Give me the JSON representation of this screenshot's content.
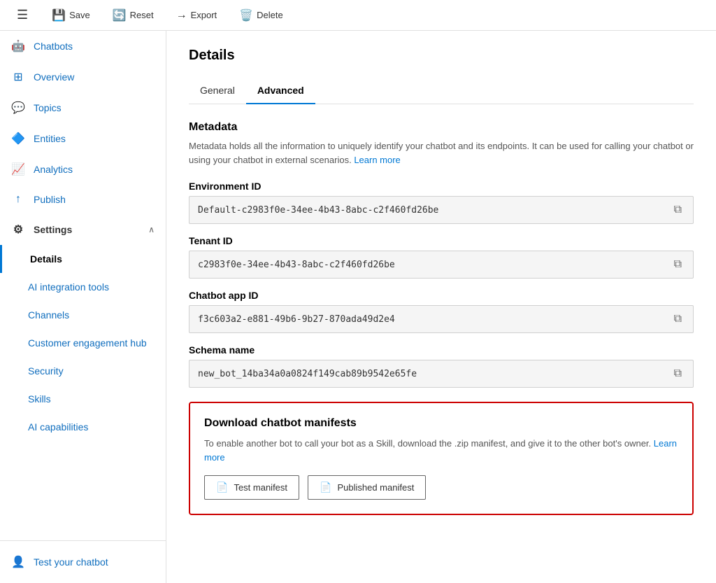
{
  "toolbar": {
    "menu_icon": "☰",
    "save_label": "Save",
    "reset_label": "Reset",
    "export_label": "Export",
    "delete_label": "Delete"
  },
  "sidebar": {
    "items": [
      {
        "id": "chatbots",
        "label": "Chatbots",
        "icon": "🤖",
        "active": false
      },
      {
        "id": "overview",
        "label": "Overview",
        "icon": "⊞",
        "active": false
      },
      {
        "id": "topics",
        "label": "Topics",
        "icon": "💬",
        "active": false
      },
      {
        "id": "entities",
        "label": "Entities",
        "icon": "🔷",
        "active": false
      },
      {
        "id": "analytics",
        "label": "Analytics",
        "icon": "📈",
        "active": false
      },
      {
        "id": "publish",
        "label": "Publish",
        "icon": "↑",
        "active": false
      }
    ],
    "settings": {
      "label": "Settings",
      "icon": "⚙",
      "chevron": "∧"
    },
    "sub_items": [
      {
        "id": "details",
        "label": "Details",
        "active": true
      },
      {
        "id": "ai-integration",
        "label": "AI integration tools",
        "active": false
      },
      {
        "id": "channels",
        "label": "Channels",
        "active": false
      },
      {
        "id": "customer-engagement",
        "label": "Customer engagement hub",
        "active": false
      },
      {
        "id": "security",
        "label": "Security",
        "active": false
      },
      {
        "id": "skills",
        "label": "Skills",
        "active": false
      },
      {
        "id": "ai-capabilities",
        "label": "AI capabilities",
        "active": false
      }
    ],
    "bottom": {
      "test_icon": "👤",
      "test_label": "Test your chatbot"
    }
  },
  "page": {
    "title": "Details",
    "tabs": [
      {
        "id": "general",
        "label": "General",
        "active": false
      },
      {
        "id": "advanced",
        "label": "Advanced",
        "active": true
      }
    ],
    "metadata": {
      "title": "Metadata",
      "description": "Metadata holds all the information to uniquely identify your chatbot and its endpoints. It can be used for calling your chatbot or using your chatbot in external scenarios.",
      "learn_more": "Learn more",
      "fields": [
        {
          "id": "environment-id",
          "label": "Environment ID",
          "value": "Default-c2983f0e-34ee-4b43-8abc-c2f460fd26be"
        },
        {
          "id": "tenant-id",
          "label": "Tenant ID",
          "value": "c2983f0e-34ee-4b43-8abc-c2f460fd26be"
        },
        {
          "id": "chatbot-app-id",
          "label": "Chatbot app ID",
          "value": "f3c603a2-e881-49b6-9b27-870ada49d2e4"
        },
        {
          "id": "schema-name",
          "label": "Schema name",
          "value": "new_bot_14ba34a0a0824f149cab89b9542e65fe"
        }
      ]
    },
    "download": {
      "title": "Download chatbot manifests",
      "description": "To enable another bot to call your bot as a Skill, download the .zip manifest, and give it to the other bot's owner.",
      "learn_more": "Learn more",
      "buttons": [
        {
          "id": "test-manifest",
          "label": "Test manifest",
          "icon": "📄"
        },
        {
          "id": "published-manifest",
          "label": "Published manifest",
          "icon": "📄"
        }
      ]
    }
  }
}
